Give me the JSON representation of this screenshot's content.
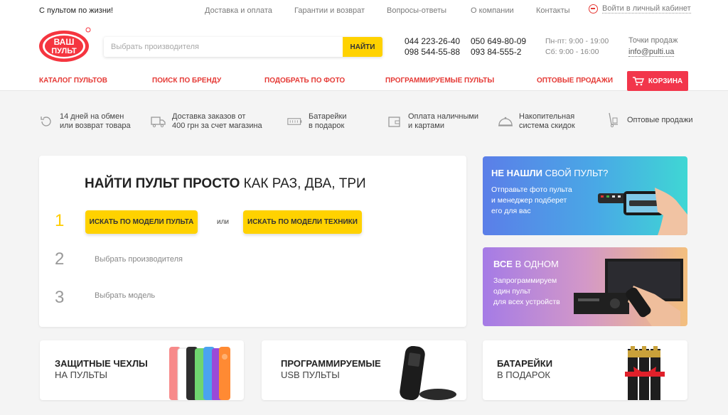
{
  "topbar": {
    "slogan": "С пультом по жизни!",
    "nav": [
      "Доставка и оплата",
      "Гарантии и возврат",
      "Вопросы-ответы",
      "О компании",
      "Контакты"
    ],
    "login": "Войти в личный кабинет"
  },
  "logo": {
    "line1": "ВАШ",
    "line2": "ПУЛЬТ"
  },
  "search": {
    "placeholder": "Выбрать производителя",
    "button": "НАЙТИ"
  },
  "phones": [
    "044 223-26-40",
    "098 544-55-88",
    "050 649-80-09",
    "093 84-555-2"
  ],
  "hours": [
    "Пн-пт: 9:00 - 19:00",
    "Сб: 9:00 - 16:00"
  ],
  "points": "Точки продаж",
  "email": "info@pulti.ua",
  "mainnav": [
    "КАТАЛОГ ПУЛЬТОВ",
    "ПОИСК ПО БРЕНДУ",
    "ПОДОБРАТЬ ПО ФОТО",
    "ПРОГРАММИРУЕМЫЕ ПУЛЬТЫ",
    "ОПТОВЫЕ ПРОДАЖИ"
  ],
  "cart": "КОРЗИНА",
  "features": [
    "14 дней на обмен\nили возврат товара",
    "Доставка заказов от\n400 грн за счет магазина",
    "Батарейки\nв подарок",
    "Оплата наличными\nи картами",
    "Накопительная\nсистема скидок",
    "Оптовые продажи"
  ],
  "finder": {
    "title_bold": "НАЙТИ ПУЛЬТ ПРОСТО",
    "title_rest": " КАК РАЗ, ДВА, ТРИ",
    "steps": [
      "1",
      "2",
      "3"
    ],
    "btn_model": "ИСКАТЬ ПО МОДЕЛИ ПУЛЬТА",
    "or": "или",
    "btn_device": "ИСКАТЬ ПО МОДЕЛИ ТЕХНИКИ",
    "step2": "Выбрать производителя",
    "step3": "Выбрать модель"
  },
  "promo1": {
    "bold": "НЕ НАШЛИ",
    "rest": " СВОЙ ПУЛЬТ?",
    "text": "Отправьте фото пульта\nи менеджер подберет\nего для вас"
  },
  "promo2": {
    "bold": "ВСЕ",
    "rest": " В ОДНОМ",
    "text": "Запрограммируем\nодин пульт\nдля всех устройств"
  },
  "bottom": [
    {
      "t1": "ЗАЩИТНЫЕ ЧЕХЛЫ",
      "t2": "НА ПУЛЬТЫ"
    },
    {
      "t1": "ПРОГРАММИРУЕМЫЕ",
      "t2": "USB ПУЛЬТЫ"
    },
    {
      "t1": "БАТАРЕЙКИ",
      "t2": "В ПОДАРОК"
    }
  ],
  "colors": {
    "accent_red": "#e53935",
    "yellow": "#ffd200",
    "cart": "#f2364b"
  }
}
